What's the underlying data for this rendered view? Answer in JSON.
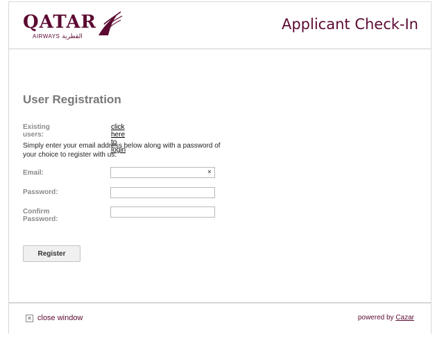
{
  "header": {
    "logo_word": "QATAR",
    "logo_sub": "AIRWAYS",
    "logo_sub_ar": "القطرية",
    "app_title": "Applicant Check-In"
  },
  "form": {
    "title": "User Registration",
    "existing_label": "Existing users:",
    "login_link": "click here to login",
    "intro": "Simply enter your email address below along with a password of your choice to register with us.",
    "email_label": "Email:",
    "email_value": "",
    "clear_glyph": "×",
    "password_label": "Password:",
    "password_value": "",
    "confirm_label": "Confirm Password:",
    "confirm_value": "",
    "register_label": "Register"
  },
  "footer": {
    "close_glyph": "✕",
    "close_label": "close window",
    "powered_prefix": "powered by",
    "powered_link": "Cazar"
  },
  "colors": {
    "brand": "#5c0a32",
    "label": "#8a8a8a"
  },
  "icons": {
    "oryx": "oryx-logo-icon",
    "clear": "clear-icon",
    "close": "close-icon"
  }
}
